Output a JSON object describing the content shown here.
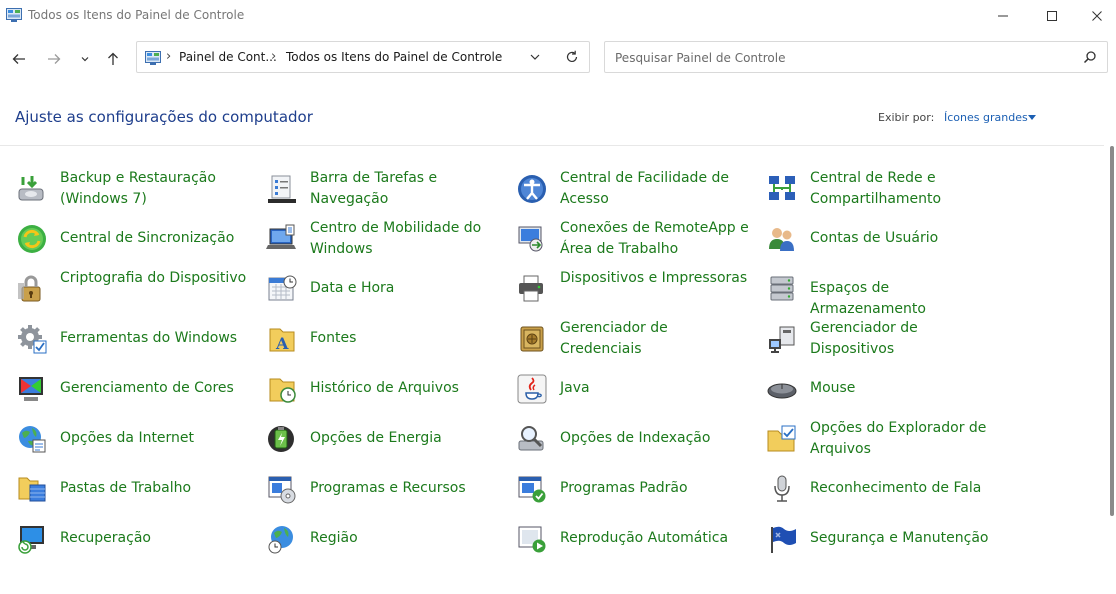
{
  "window": {
    "title": "Todos os Itens do Painel de Controle"
  },
  "address": {
    "crumbs": [
      "Painel de Cont...",
      "Todos os Itens do Painel de Controle"
    ]
  },
  "search": {
    "placeholder": "Pesquisar Painel de Controle"
  },
  "header": {
    "heading": "Ajuste as configurações do computador",
    "view_label": "Exibir por:",
    "view_value": "Ícones grandes"
  },
  "colors": {
    "link_green": "#1c7a1c",
    "heading_blue": "#1e3e8c",
    "accent_blue": "#1b5fb3"
  },
  "items": [
    {
      "label": "Backup e Restauração (Windows 7)",
      "icon": "backup-icon"
    },
    {
      "label": "Barra de Tarefas e Navegação",
      "icon": "taskbar-icon"
    },
    {
      "label": "Central de Facilidade de Acesso",
      "icon": "accessibility-icon"
    },
    {
      "label": "Central de Rede e Compartilhamento",
      "icon": "network-icon"
    },
    {
      "label": "Central de Sincronização",
      "icon": "sync-icon"
    },
    {
      "label": "Centro de Mobilidade do Windows",
      "icon": "mobility-icon"
    },
    {
      "label": "Conexões de RemoteApp e Área de Trabalho",
      "icon": "remoteapp-icon"
    },
    {
      "label": "Contas de Usuário",
      "icon": "users-icon"
    },
    {
      "label": "Criptografia do Dispositivo",
      "icon": "encryption-icon"
    },
    {
      "label": "Data e Hora",
      "icon": "calendar-clock-icon"
    },
    {
      "label": "Dispositivos e Impressoras",
      "icon": "printer-icon"
    },
    {
      "label": "Espaços de Armazenamento",
      "icon": "storage-icon"
    },
    {
      "label": "Ferramentas do Windows",
      "icon": "gear-icon"
    },
    {
      "label": "Fontes",
      "icon": "fonts-icon"
    },
    {
      "label": "Gerenciador de Credenciais",
      "icon": "credential-vault-icon"
    },
    {
      "label": "Gerenciador de Dispositivos",
      "icon": "device-manager-icon"
    },
    {
      "label": "Gerenciamento de Cores",
      "icon": "color-management-icon"
    },
    {
      "label": "Histórico de Arquivos",
      "icon": "file-history-icon"
    },
    {
      "label": "Java",
      "icon": "java-icon"
    },
    {
      "label": "Mouse",
      "icon": "mouse-icon"
    },
    {
      "label": "Opções da Internet",
      "icon": "internet-globe-icon"
    },
    {
      "label": "Opções de Energia",
      "icon": "battery-icon"
    },
    {
      "label": "Opções de Indexação",
      "icon": "indexing-icon"
    },
    {
      "label": "Opções do Explorador de Arquivos",
      "icon": "folder-options-icon"
    },
    {
      "label": "Pastas de Trabalho",
      "icon": "work-folders-icon"
    },
    {
      "label": "Programas e Recursos",
      "icon": "programs-icon"
    },
    {
      "label": "Programas Padrão",
      "icon": "default-programs-icon"
    },
    {
      "label": "Reconhecimento de Fala",
      "icon": "microphone-icon"
    },
    {
      "label": "Recuperação",
      "icon": "recovery-icon"
    },
    {
      "label": "Região",
      "icon": "region-globe-icon"
    },
    {
      "label": "Reprodução Automática",
      "icon": "autoplay-icon"
    },
    {
      "label": "Segurança e Manutenção",
      "icon": "security-flag-icon"
    }
  ]
}
